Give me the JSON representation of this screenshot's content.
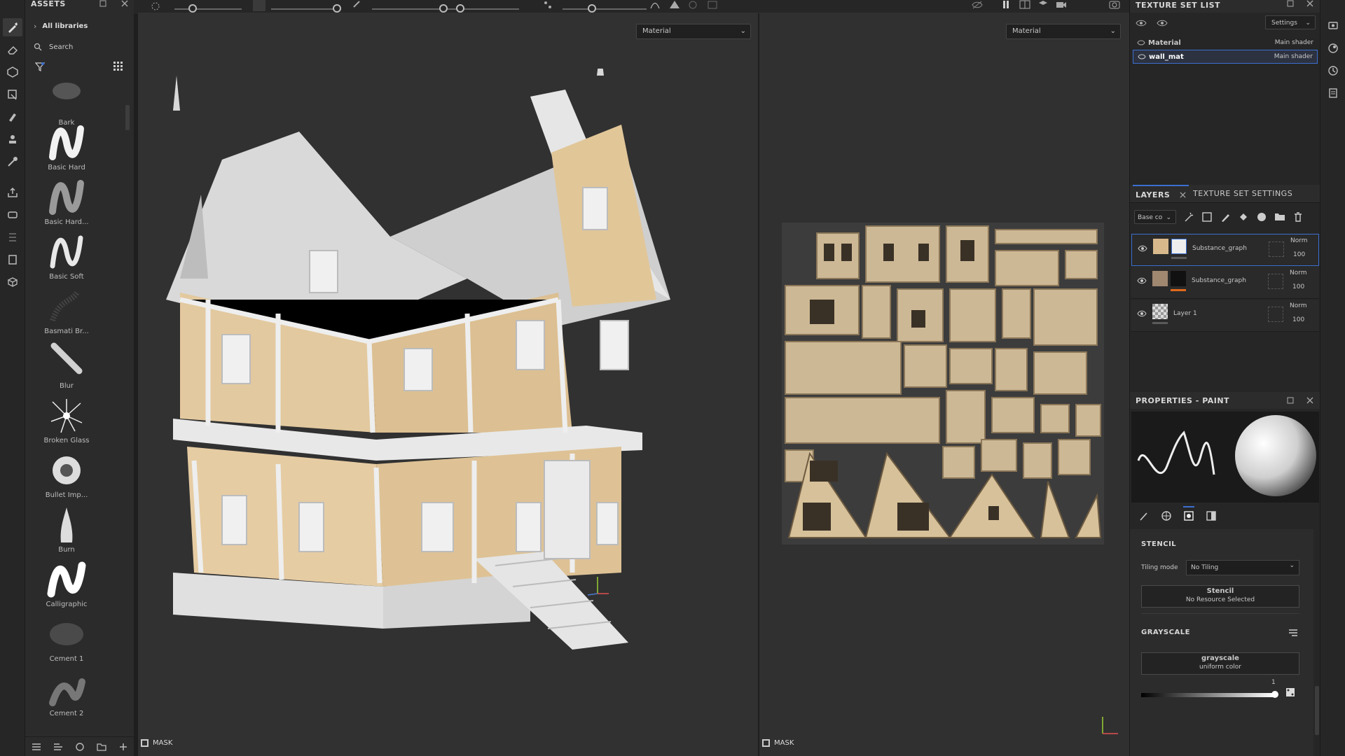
{
  "assets": {
    "title": "ASSETS",
    "breadcrumb": "All libraries",
    "search_placeholder": "Search",
    "brushes": [
      {
        "label": "Bark"
      },
      {
        "label": "Basic Hard"
      },
      {
        "label": "Basic Hard..."
      },
      {
        "label": "Basic Soft"
      },
      {
        "label": "Basmati Br..."
      },
      {
        "label": "Blur"
      },
      {
        "label": "Broken Glass"
      },
      {
        "label": "Bullet Imp..."
      },
      {
        "label": "Burn"
      },
      {
        "label": "Calligraphic"
      },
      {
        "label": "Cement 1"
      },
      {
        "label": "Cement 2"
      }
    ]
  },
  "viewport3d": {
    "dropdown": "Material",
    "mask_label": "MASK"
  },
  "viewport2d": {
    "dropdown": "Material",
    "mask_label": "MASK"
  },
  "texture_set_list": {
    "title": "TEXTURE SET LIST",
    "settings_label": "Settings",
    "sets": [
      {
        "name": "Material",
        "shader": "Main shader"
      },
      {
        "name": "wall_mat",
        "shader": "Main shader"
      }
    ]
  },
  "layers_panel": {
    "tab_layers": "LAYERS",
    "tab_texture_settings": "TEXTURE SET SETTINGS",
    "channel_dropdown": "Base co",
    "layers": [
      {
        "name": "Substance_graph",
        "blend": "Norm",
        "opacity": "100",
        "accent": "#5a5a5a"
      },
      {
        "name": "Substance_graph",
        "blend": "Norm",
        "opacity": "100",
        "accent": "#e06a1c"
      },
      {
        "name": "Layer 1",
        "blend": "Norm",
        "opacity": "100",
        "accent": "#5a5a5a"
      }
    ]
  },
  "properties": {
    "title": "PROPERTIES - PAINT",
    "stencil_header": "STENCIL",
    "tiling_label": "Tiling mode",
    "tiling_value": "No Tiling",
    "stencil_title": "Stencil",
    "stencil_value": "No Resource Selected",
    "grayscale_header": "GRAYSCALE",
    "grayscale_title": "grayscale",
    "grayscale_value": "uniform color",
    "grayscale_slider_value": "1"
  },
  "colors": {
    "accent": "#3c6fd0",
    "orange": "#e06a1c"
  }
}
